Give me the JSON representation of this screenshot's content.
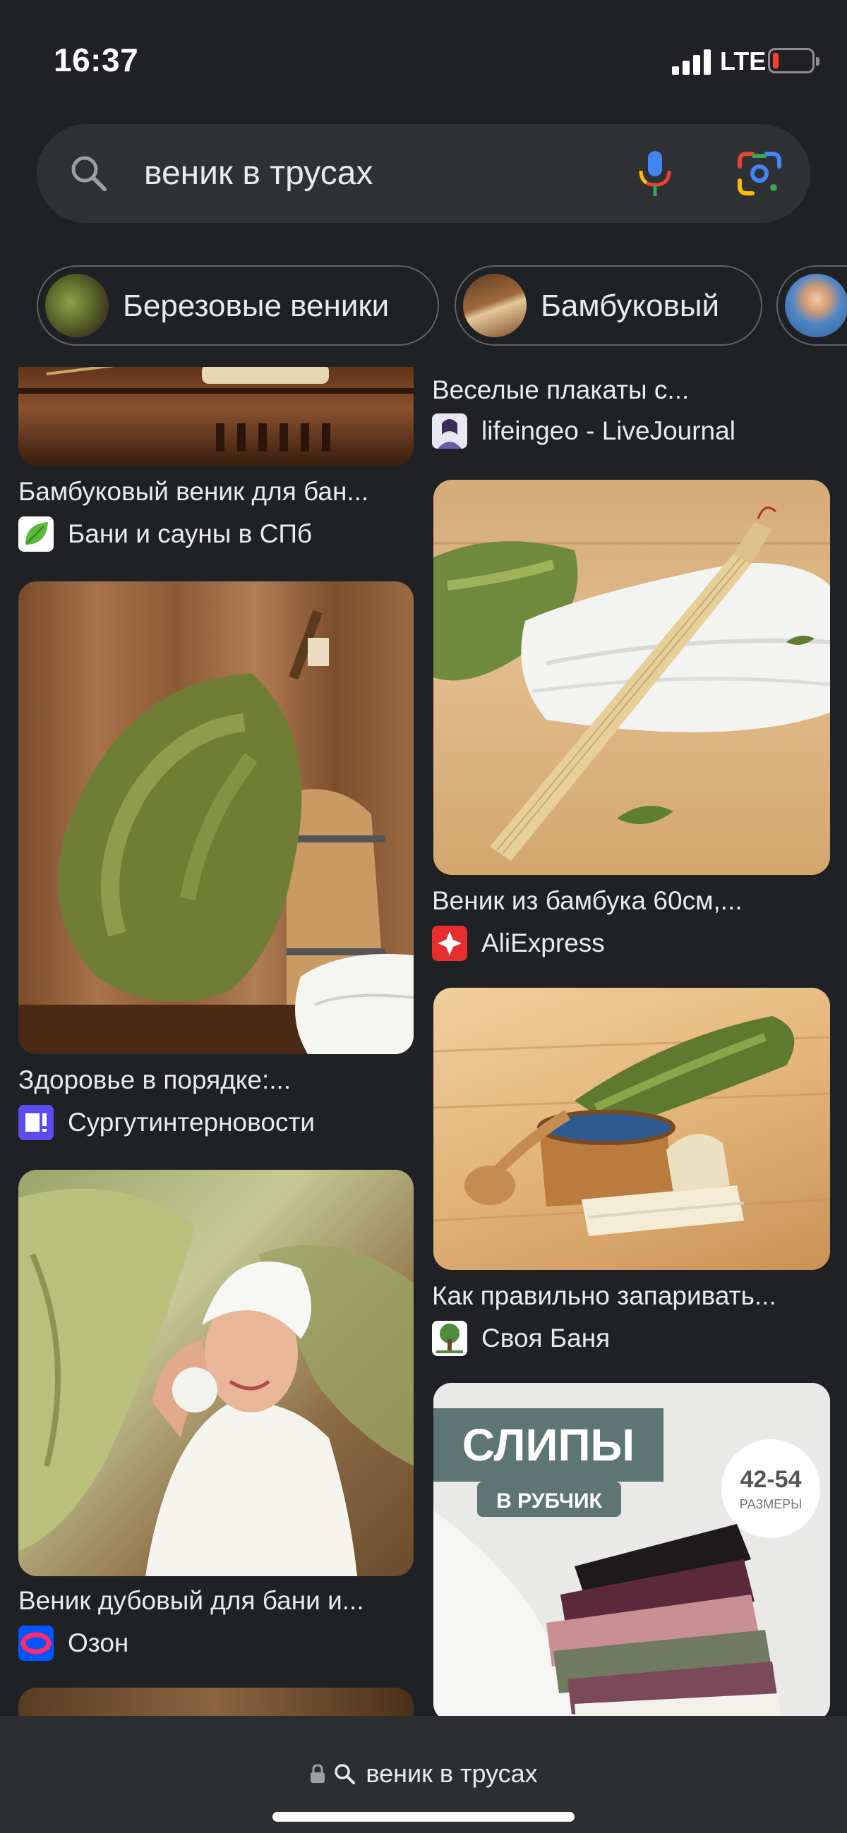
{
  "status_bar": {
    "time": "16:37",
    "network": "LTE",
    "battery_level": 0.1,
    "signal_bars": 4
  },
  "search": {
    "query": "веник в трусах",
    "icons": [
      "search-icon",
      "microphone-icon",
      "google-lens-icon"
    ]
  },
  "chips": [
    {
      "label": "Березовые веники",
      "thumb_color": "#6b7b3a"
    },
    {
      "label": "Бамбуковый",
      "thumb_color": "#8a5a32"
    },
    {
      "label": "",
      "thumb_color": "#5a88b8"
    }
  ],
  "results": {
    "left": [
      {
        "title": "Бамбуковый веник для бан...",
        "source": "Бани и сауны в СПб",
        "favicon": "leaf-favicon"
      },
      {
        "title": "Здоровье в порядке:...",
        "source": "Сургутинтерновости",
        "favicon": "news-favicon"
      },
      {
        "title": "Веник дубовый для бани и...",
        "source": "Озон",
        "favicon": "ozon-favicon"
      }
    ],
    "right": [
      {
        "title": "Веселые плакаты с...",
        "source": "lifeingeo - LiveJournal",
        "favicon": "avatar-favicon"
      },
      {
        "title": "Веник из бамбука 60см,...",
        "source": "AliExpress",
        "favicon": "aliexpress-favicon"
      },
      {
        "title": "Как правильно запаривать...",
        "source": "Своя Баня",
        "favicon": "tree-favicon"
      },
      {
        "title": "",
        "source": "",
        "favicon": ""
      }
    ],
    "image_texts": {
      "slips_title": "СЛИПЫ",
      "slips_subtitle": "В РУБЧИК",
      "slips_sizes": "42-54",
      "slips_sizes_label": "РАЗМЕРЫ"
    }
  },
  "bottom_bar": {
    "url_text": "веник в трусах"
  },
  "colors": {
    "background": "#202124",
    "search_bg": "#303134",
    "chip_border": "#5f6368",
    "text": "#e8eaed",
    "battery_low": "#ff3b30"
  }
}
